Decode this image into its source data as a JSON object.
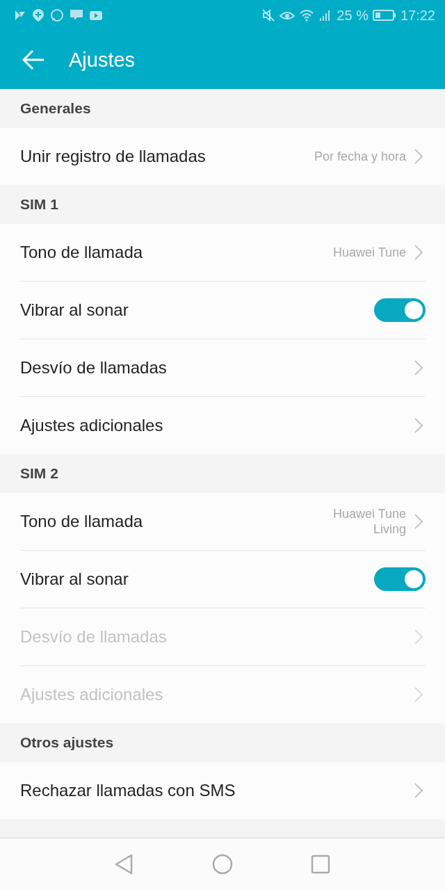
{
  "status_bar": {
    "battery": "25 %",
    "time": "17:22"
  },
  "app_bar": {
    "title": "Ajustes"
  },
  "sections": [
    {
      "title": "Generales",
      "items": [
        {
          "kind": "value",
          "label": "Unir registro de llamadas",
          "value": "Por fecha y hora",
          "disabled": false
        }
      ]
    },
    {
      "title": "SIM 1",
      "items": [
        {
          "kind": "value",
          "label": "Tono de llamada",
          "value": "Huawei Tune",
          "disabled": false
        },
        {
          "kind": "toggle",
          "label": "Vibrar al sonar",
          "on": true,
          "disabled": false
        },
        {
          "kind": "link",
          "label": "Desvío de llamadas",
          "disabled": false
        },
        {
          "kind": "link",
          "label": "Ajustes adicionales",
          "disabled": false
        }
      ]
    },
    {
      "title": "SIM 2",
      "items": [
        {
          "kind": "value",
          "label": "Tono de llamada",
          "value": "Huawei Tune Living",
          "disabled": false
        },
        {
          "kind": "toggle",
          "label": "Vibrar al sonar",
          "on": true,
          "disabled": false
        },
        {
          "kind": "link",
          "label": "Desvío de llamadas",
          "disabled": true
        },
        {
          "kind": "link",
          "label": "Ajustes adicionales",
          "disabled": true
        }
      ]
    },
    {
      "title": "Otros ajustes",
      "items": [
        {
          "kind": "link",
          "label": "Rechazar llamadas con SMS",
          "disabled": false
        }
      ]
    }
  ]
}
